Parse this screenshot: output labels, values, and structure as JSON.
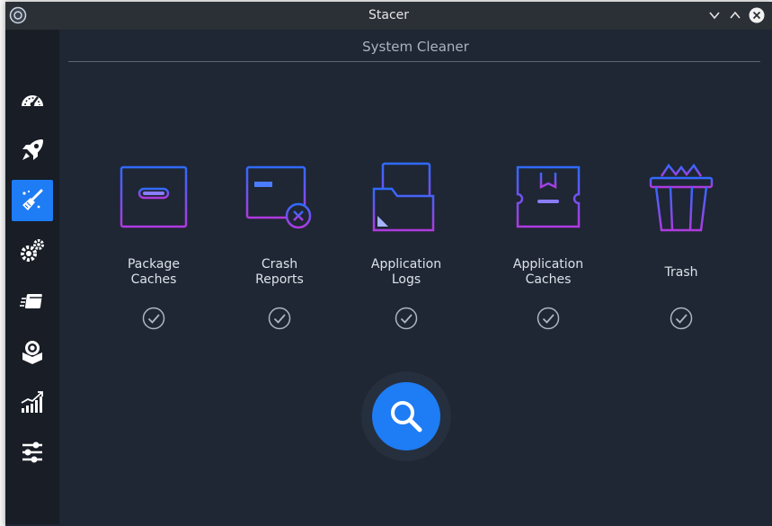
{
  "window": {
    "title": "Stacer"
  },
  "page": {
    "title": "System Cleaner"
  },
  "sidebar": {
    "items": [
      {
        "name": "dashboard",
        "icon": "speedometer-icon",
        "active": false
      },
      {
        "name": "startup-apps",
        "icon": "rocket-icon",
        "active": false
      },
      {
        "name": "system-cleaner",
        "icon": "broom-icon",
        "active": true
      },
      {
        "name": "services",
        "icon": "gears-icon",
        "active": false
      },
      {
        "name": "processes",
        "icon": "processes-icon",
        "active": false
      },
      {
        "name": "uninstaller",
        "icon": "package-icon",
        "active": false
      },
      {
        "name": "resources",
        "icon": "chart-icon",
        "active": false
      },
      {
        "name": "settings",
        "icon": "sliders-icon",
        "active": false
      }
    ]
  },
  "categories": [
    {
      "label": "Package\nCaches",
      "icon": "package-caches-icon",
      "checked": true
    },
    {
      "label": "Crash\nReports",
      "icon": "crash-reports-icon",
      "checked": true
    },
    {
      "label": "Application\nLogs",
      "icon": "application-logs-icon",
      "checked": true
    },
    {
      "label": "Application\nCaches",
      "icon": "application-caches-icon",
      "checked": true
    },
    {
      "label": "Trash",
      "icon": "trash-icon",
      "checked": true
    }
  ],
  "colors": {
    "accent": "#1e7cf4",
    "background": "#1f2634",
    "sidebar": "#181d26",
    "gradient_start": "#2f6bff",
    "gradient_end": "#b03ae0"
  },
  "scan": {
    "icon": "search-icon"
  }
}
